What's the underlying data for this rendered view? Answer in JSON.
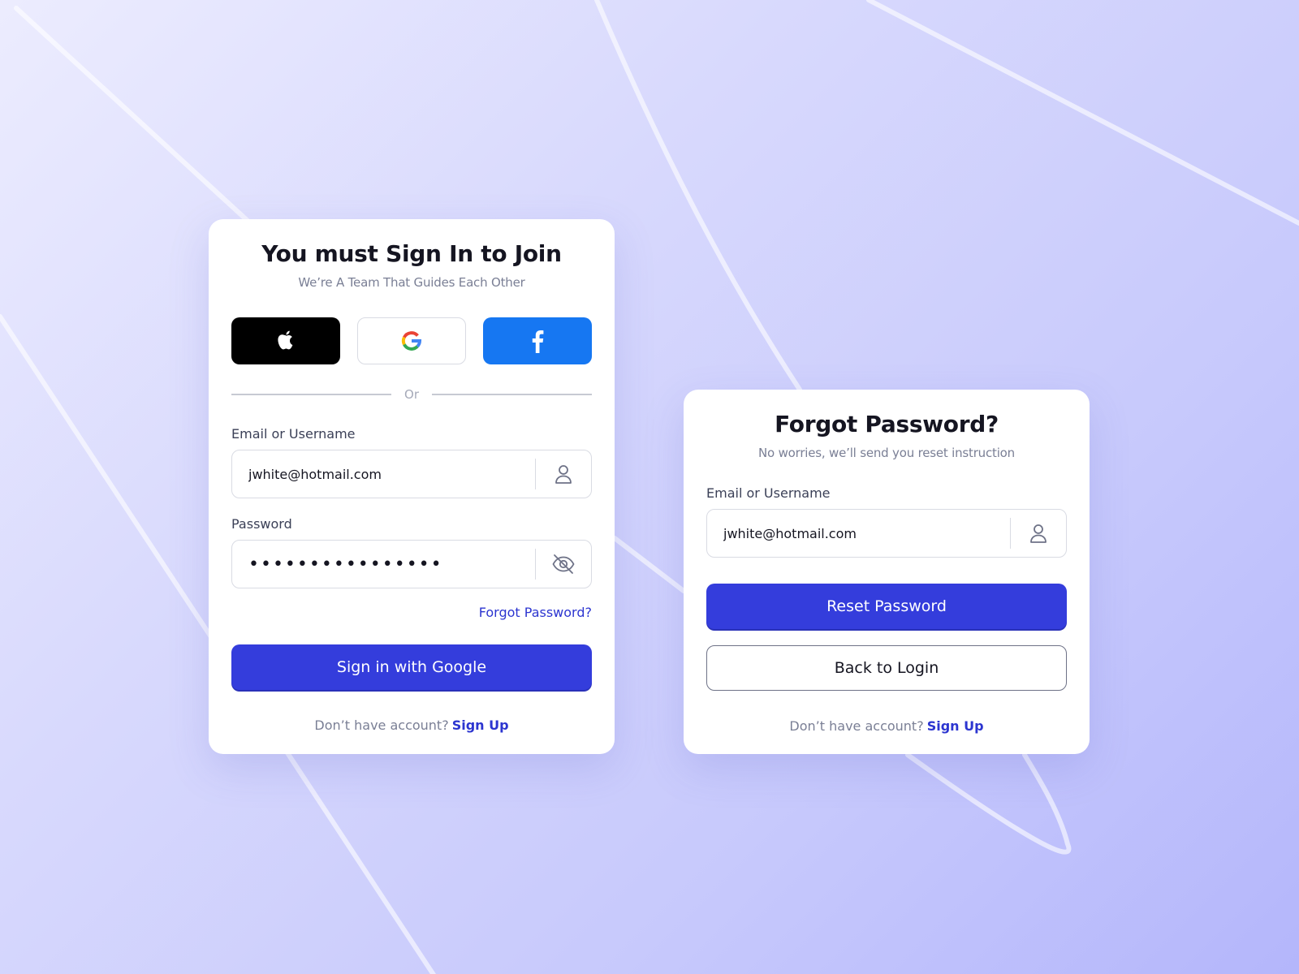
{
  "colors": {
    "primary": "#343ddc",
    "link": "#2c35d0",
    "facebook": "#1677f2",
    "apple": "#000000",
    "title": "#151521",
    "muted": "#7a7f95"
  },
  "signin_card": {
    "title": "You must Sign In to Join",
    "subtitle": "We’re A Team That Guides Each Other",
    "social_buttons": [
      {
        "provider": "apple",
        "icon": "apple-icon"
      },
      {
        "provider": "google",
        "icon": "google-icon"
      },
      {
        "provider": "facebook",
        "icon": "facebook-icon"
      }
    ],
    "divider_text": "Or",
    "email_label": "Email or Username",
    "email_value": "jwhite@hotmail.com",
    "email_icon": "user-icon",
    "password_label": "Password",
    "password_value": "••••••••••••••••",
    "password_icon": "eye-off-icon",
    "forgot_link": "Forgot Password?",
    "submit_label": "Sign in with Google",
    "footer_text": "Don’t have account?",
    "footer_link": "Sign Up"
  },
  "forgot_card": {
    "title": "Forgot Password?",
    "subtitle": "No worries, we’ll send you reset instruction",
    "email_label": "Email or Username",
    "email_value": "jwhite@hotmail.com",
    "email_icon": "user-icon",
    "reset_label": "Reset Password",
    "back_label": "Back to Login",
    "footer_text": "Don’t have account?",
    "footer_link": "Sign Up"
  }
}
